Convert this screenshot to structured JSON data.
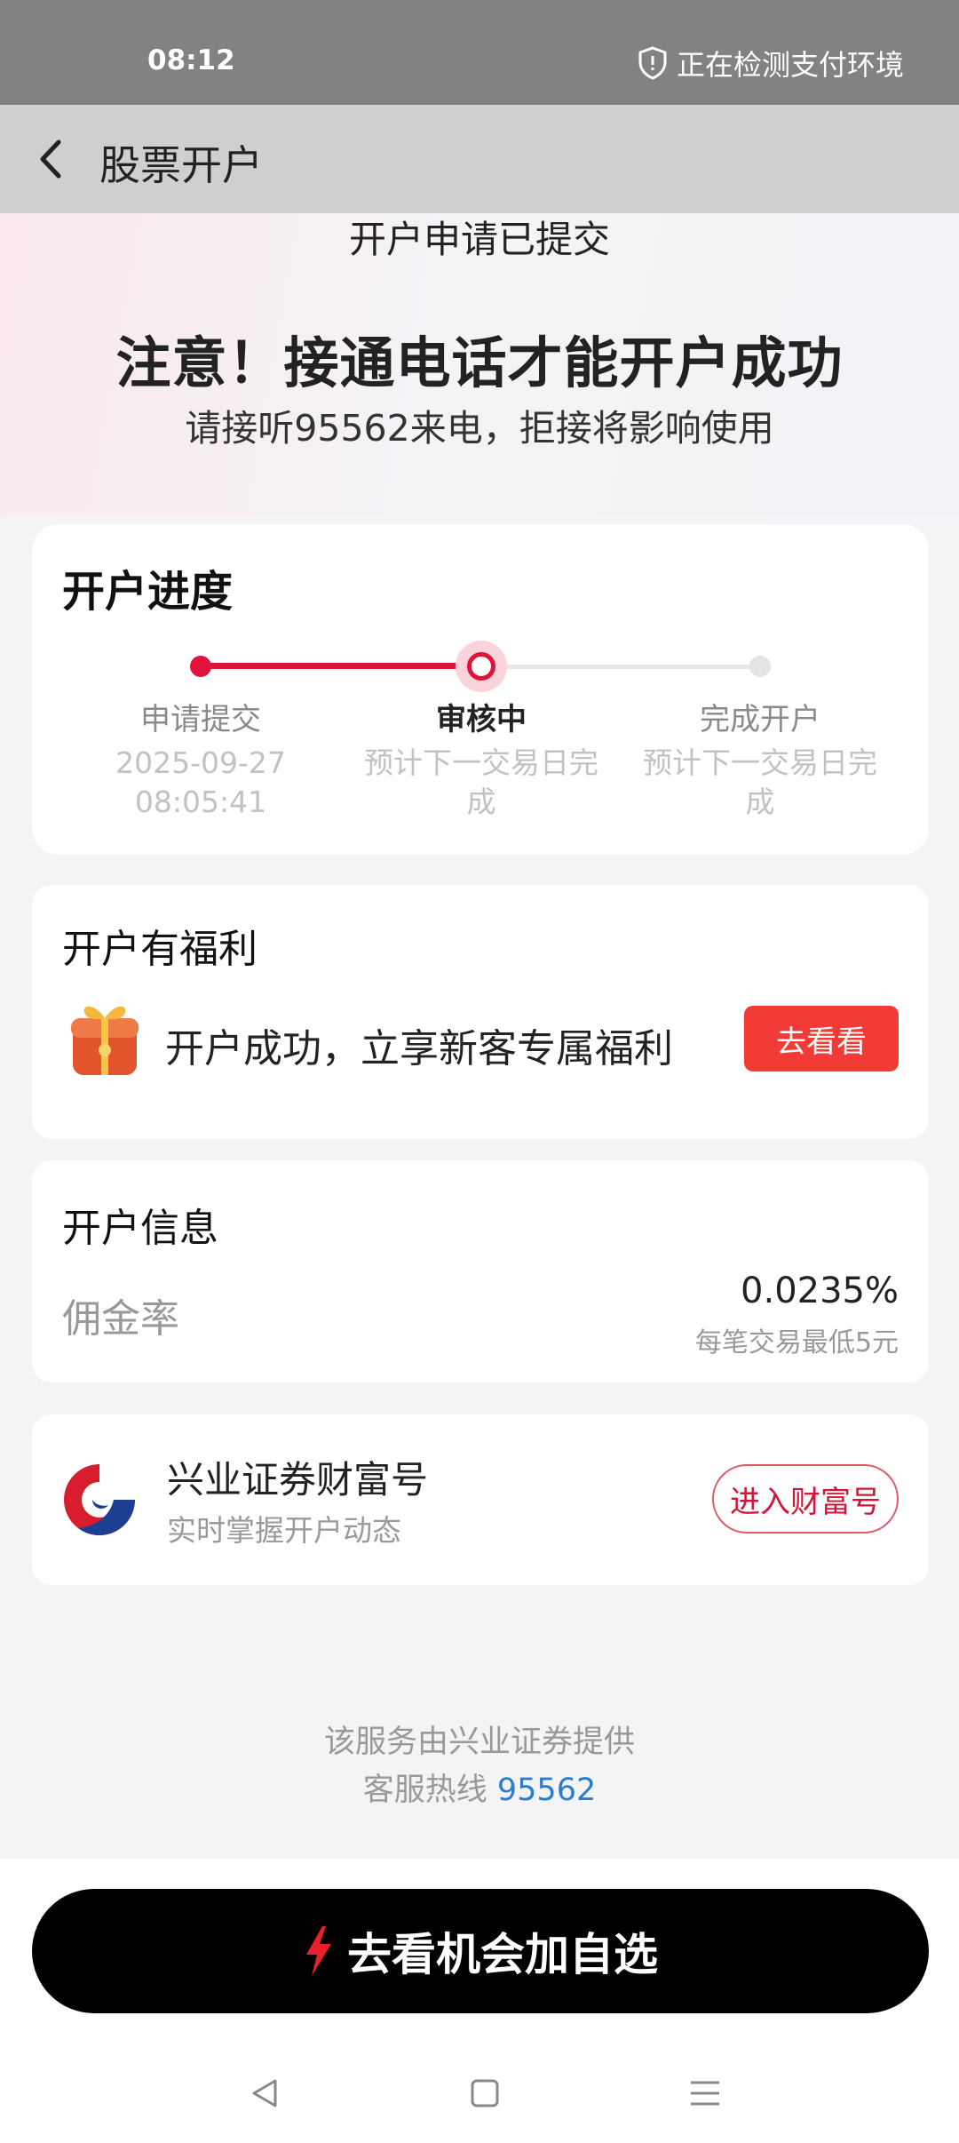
{
  "status_bar": {
    "time": "08:12",
    "status_text": "正在检测支付环境"
  },
  "nav": {
    "title": "股票开户"
  },
  "header": {
    "subtitle": "开户申请已提交",
    "title": "注意！接通电话才能开户成功",
    "desc": "请接听95562来电，拒接将影响使用"
  },
  "progress": {
    "title": "开户进度",
    "steps": [
      {
        "label": "申请提交",
        "sub1": "2025-09-27",
        "sub2": "08:05:41",
        "state": "done"
      },
      {
        "label": "审核中",
        "sub1": "预计下一交易日完",
        "sub2": "成",
        "state": "active"
      },
      {
        "label": "完成开户",
        "sub1": "预计下一交易日完",
        "sub2": "成",
        "state": "pending"
      }
    ]
  },
  "welfare": {
    "title": "开户有福利",
    "text": "开户成功，立享新客专属福利",
    "button": "去看看",
    "icon": "gift-icon"
  },
  "info": {
    "title": "开户信息",
    "label": "佣金率",
    "value": "0.0235%",
    "note": "每笔交易最低5元"
  },
  "account": {
    "title": "兴业证券财富号",
    "subtitle": "实时掌握开户动态",
    "button": "进入财富号",
    "icon": "industrial-securities-logo"
  },
  "footer": {
    "line1": "该服务由兴业证券提供",
    "hotline_label": "客服热线 ",
    "hotline_number": "95562"
  },
  "cta": {
    "label": "去看机会加自选",
    "icon": "lightning-icon"
  },
  "colors": {
    "accent_red": "#e0143b",
    "button_red": "#f23b36",
    "link_blue": "#2b7ccc"
  }
}
